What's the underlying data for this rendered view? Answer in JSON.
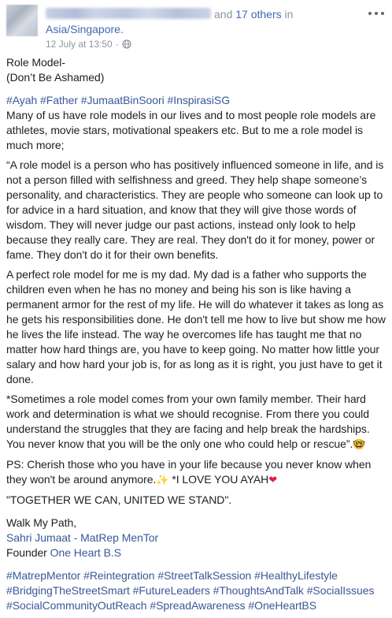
{
  "header": {
    "and_text": "and",
    "others_link": "17 others",
    "in_text": "in",
    "location": "Asia/Singapore.",
    "timestamp": "12 July at 13:50",
    "dot": "·"
  },
  "post": {
    "title_lines": "Role Model-\n(Don’t Be Ashamed)",
    "intro_hashtags": [
      "#Ayah",
      "#Father",
      "#JumaatBinSoori",
      "#InspirasiSG"
    ],
    "p1": "Many of us have role models in our lives and to most people role models are athletes, movie stars, motivational speakers etc. But to me a role model is much more;",
    "p2": "“A role model is a person who has positively influenced someone in life, and is not a person filled with selfishness and greed. They help shape someone’s personality, and characteristics. They are people who someone can look up to for advice in a hard situation, and know that they will give those words of wisdom. They will never judge our past actions, instead only look to help because they really care. They are real. They don't do it for money, power or fame. They don't do it for their own benefits.",
    "p3": "A perfect role model for me is my dad. My dad is a father who supports the children even when he has no money and being his son is like having a permanent armor for the rest of my life. He will do whatever it takes as long as he gets his responsibilities done. He don't tell me how to live but show me how he lives the life instead. The way he overcomes life has taught me that no matter how hard things are, you have to keep going. No matter how little your salary and how hard your job is, for as long as it is right, you just have to get it done.",
    "p4": "*Sometimes a role model comes from your own family member. Their hard work and determination is what we should recognise. From there you could understand the struggles that they are facing and help break the hardships. You never know that you will be the only one who could help or rescue”.",
    "p4_emoji": "🤓",
    "p5_start": "PS: Cherish those who you have in your life because you never know when they won't be around anymore.",
    "p5_sparkle": "✨",
    "p5_mid": " *I LOVE YOU AYAH",
    "p5_heart": "❤",
    "p6": "\"TOGETHER WE CAN, UNITED WE STAND\".",
    "sign_walk": "Walk My Path,",
    "sign_name": "Sahri Jumaat - MatRep MenTor",
    "sign_founder_prefix": "Founder ",
    "sign_founder_link": "One Heart B.S",
    "footer_hashtags": [
      "#MatrepMentor",
      "#Reintegration",
      "#StreetTalkSession",
      "#HealthyLifestyle",
      "#BridgingTheStreetSmart",
      "#FutureLeaders",
      "#ThoughtsAndTalk",
      "#SocialIssues",
      "#SocialCommunityOutReach",
      "#SpreadAwareness",
      "#OneHeartBS"
    ]
  },
  "icons": {
    "globe": "globe-icon",
    "more": "more-options-icon"
  },
  "colors": {
    "link": "#385898",
    "meta": "#90949c",
    "heart": "#e41e3f"
  }
}
